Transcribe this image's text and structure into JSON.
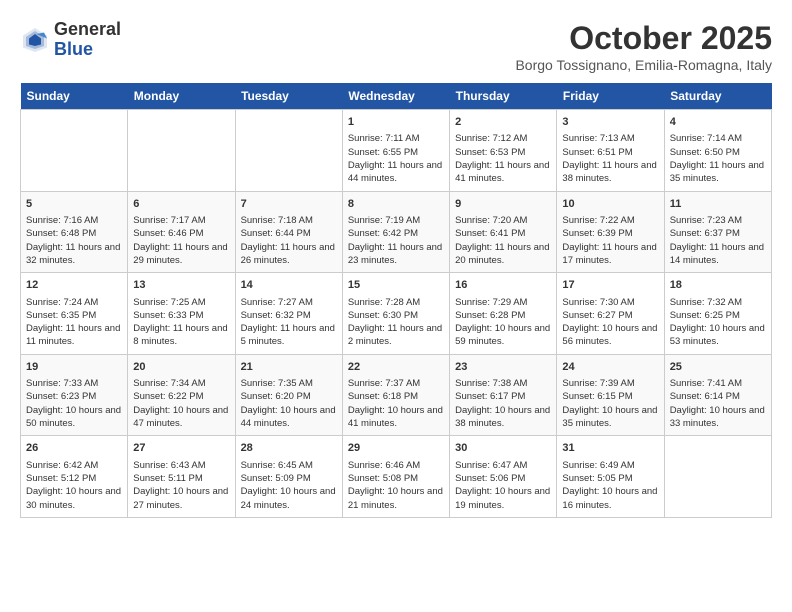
{
  "header": {
    "logo_general": "General",
    "logo_blue": "Blue",
    "month_title": "October 2025",
    "subtitle": "Borgo Tossignano, Emilia-Romagna, Italy"
  },
  "weekdays": [
    "Sunday",
    "Monday",
    "Tuesday",
    "Wednesday",
    "Thursday",
    "Friday",
    "Saturday"
  ],
  "weeks": [
    [
      {
        "day": "",
        "info": ""
      },
      {
        "day": "",
        "info": ""
      },
      {
        "day": "",
        "info": ""
      },
      {
        "day": "1",
        "info": "Sunrise: 7:11 AM\nSunset: 6:55 PM\nDaylight: 11 hours and 44 minutes."
      },
      {
        "day": "2",
        "info": "Sunrise: 7:12 AM\nSunset: 6:53 PM\nDaylight: 11 hours and 41 minutes."
      },
      {
        "day": "3",
        "info": "Sunrise: 7:13 AM\nSunset: 6:51 PM\nDaylight: 11 hours and 38 minutes."
      },
      {
        "day": "4",
        "info": "Sunrise: 7:14 AM\nSunset: 6:50 PM\nDaylight: 11 hours and 35 minutes."
      }
    ],
    [
      {
        "day": "5",
        "info": "Sunrise: 7:16 AM\nSunset: 6:48 PM\nDaylight: 11 hours and 32 minutes."
      },
      {
        "day": "6",
        "info": "Sunrise: 7:17 AM\nSunset: 6:46 PM\nDaylight: 11 hours and 29 minutes."
      },
      {
        "day": "7",
        "info": "Sunrise: 7:18 AM\nSunset: 6:44 PM\nDaylight: 11 hours and 26 minutes."
      },
      {
        "day": "8",
        "info": "Sunrise: 7:19 AM\nSunset: 6:42 PM\nDaylight: 11 hours and 23 minutes."
      },
      {
        "day": "9",
        "info": "Sunrise: 7:20 AM\nSunset: 6:41 PM\nDaylight: 11 hours and 20 minutes."
      },
      {
        "day": "10",
        "info": "Sunrise: 7:22 AM\nSunset: 6:39 PM\nDaylight: 11 hours and 17 minutes."
      },
      {
        "day": "11",
        "info": "Sunrise: 7:23 AM\nSunset: 6:37 PM\nDaylight: 11 hours and 14 minutes."
      }
    ],
    [
      {
        "day": "12",
        "info": "Sunrise: 7:24 AM\nSunset: 6:35 PM\nDaylight: 11 hours and 11 minutes."
      },
      {
        "day": "13",
        "info": "Sunrise: 7:25 AM\nSunset: 6:33 PM\nDaylight: 11 hours and 8 minutes."
      },
      {
        "day": "14",
        "info": "Sunrise: 7:27 AM\nSunset: 6:32 PM\nDaylight: 11 hours and 5 minutes."
      },
      {
        "day": "15",
        "info": "Sunrise: 7:28 AM\nSunset: 6:30 PM\nDaylight: 11 hours and 2 minutes."
      },
      {
        "day": "16",
        "info": "Sunrise: 7:29 AM\nSunset: 6:28 PM\nDaylight: 10 hours and 59 minutes."
      },
      {
        "day": "17",
        "info": "Sunrise: 7:30 AM\nSunset: 6:27 PM\nDaylight: 10 hours and 56 minutes."
      },
      {
        "day": "18",
        "info": "Sunrise: 7:32 AM\nSunset: 6:25 PM\nDaylight: 10 hours and 53 minutes."
      }
    ],
    [
      {
        "day": "19",
        "info": "Sunrise: 7:33 AM\nSunset: 6:23 PM\nDaylight: 10 hours and 50 minutes."
      },
      {
        "day": "20",
        "info": "Sunrise: 7:34 AM\nSunset: 6:22 PM\nDaylight: 10 hours and 47 minutes."
      },
      {
        "day": "21",
        "info": "Sunrise: 7:35 AM\nSunset: 6:20 PM\nDaylight: 10 hours and 44 minutes."
      },
      {
        "day": "22",
        "info": "Sunrise: 7:37 AM\nSunset: 6:18 PM\nDaylight: 10 hours and 41 minutes."
      },
      {
        "day": "23",
        "info": "Sunrise: 7:38 AM\nSunset: 6:17 PM\nDaylight: 10 hours and 38 minutes."
      },
      {
        "day": "24",
        "info": "Sunrise: 7:39 AM\nSunset: 6:15 PM\nDaylight: 10 hours and 35 minutes."
      },
      {
        "day": "25",
        "info": "Sunrise: 7:41 AM\nSunset: 6:14 PM\nDaylight: 10 hours and 33 minutes."
      }
    ],
    [
      {
        "day": "26",
        "info": "Sunrise: 6:42 AM\nSunset: 5:12 PM\nDaylight: 10 hours and 30 minutes."
      },
      {
        "day": "27",
        "info": "Sunrise: 6:43 AM\nSunset: 5:11 PM\nDaylight: 10 hours and 27 minutes."
      },
      {
        "day": "28",
        "info": "Sunrise: 6:45 AM\nSunset: 5:09 PM\nDaylight: 10 hours and 24 minutes."
      },
      {
        "day": "29",
        "info": "Sunrise: 6:46 AM\nSunset: 5:08 PM\nDaylight: 10 hours and 21 minutes."
      },
      {
        "day": "30",
        "info": "Sunrise: 6:47 AM\nSunset: 5:06 PM\nDaylight: 10 hours and 19 minutes."
      },
      {
        "day": "31",
        "info": "Sunrise: 6:49 AM\nSunset: 5:05 PM\nDaylight: 10 hours and 16 minutes."
      },
      {
        "day": "",
        "info": ""
      }
    ]
  ]
}
